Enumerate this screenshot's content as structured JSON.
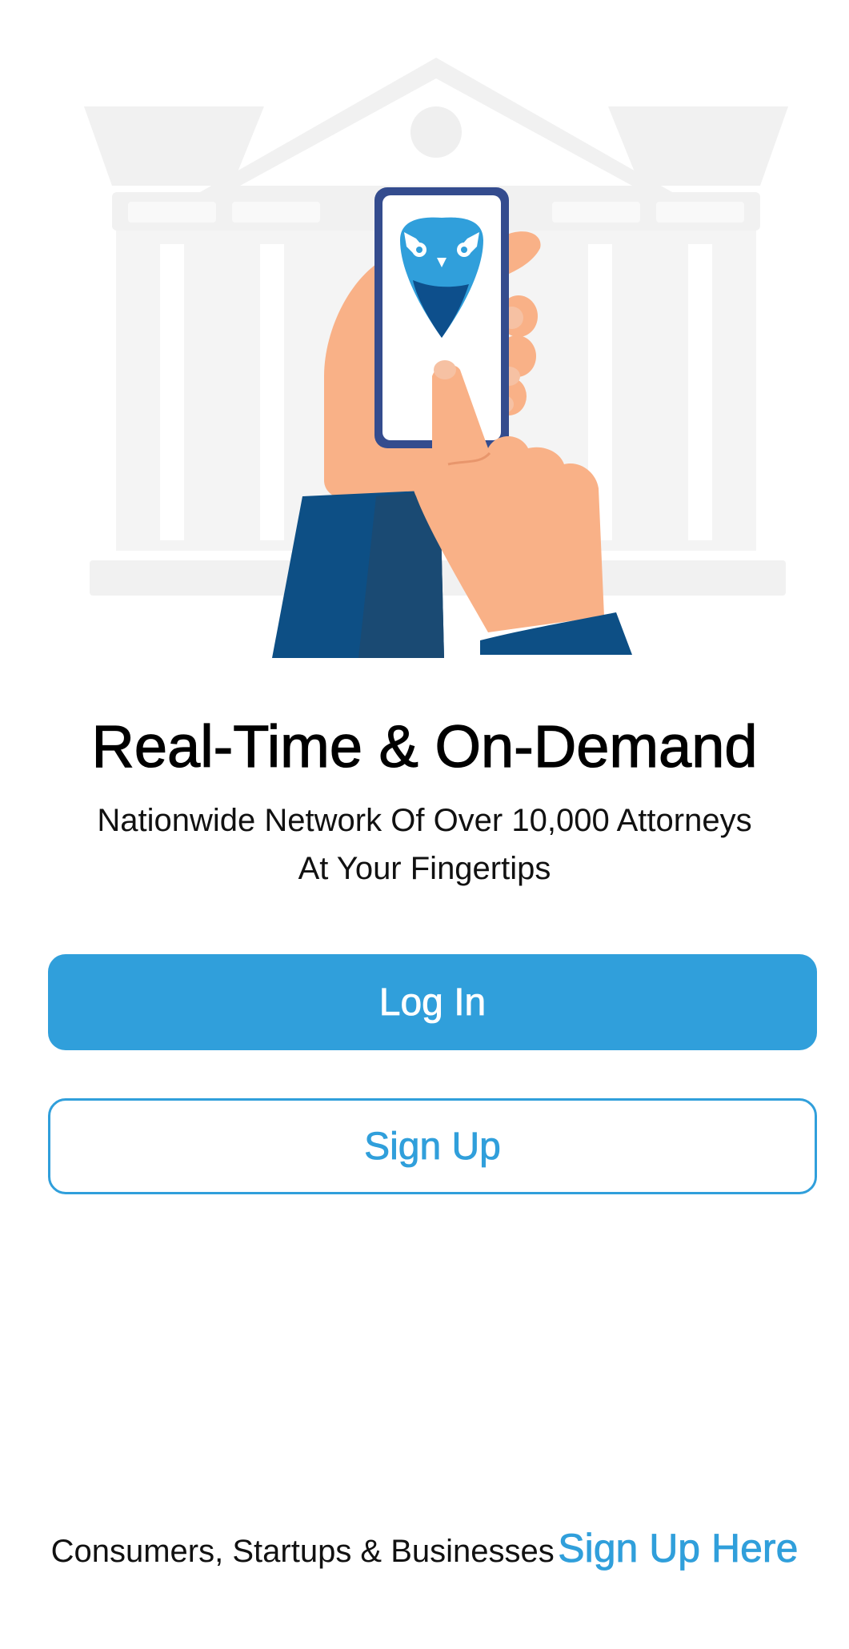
{
  "hero": {
    "illustration": "hand-holding-phone-with-owl-logo-over-courthouse"
  },
  "headline": {
    "title": "Real-Time & On-Demand",
    "subtitle_line1": "Nationwide Network Of Over 10,000 Attorneys",
    "subtitle_line2": "At Your Fingertips"
  },
  "actions": {
    "login_label": "Log In",
    "signup_label": "Sign Up"
  },
  "footer": {
    "text": "Consumers, Startups & Businesses",
    "link_label": "Sign Up Here"
  },
  "colors": {
    "accent": "#309fdb",
    "background": "#ffffff",
    "text": "#000000"
  }
}
